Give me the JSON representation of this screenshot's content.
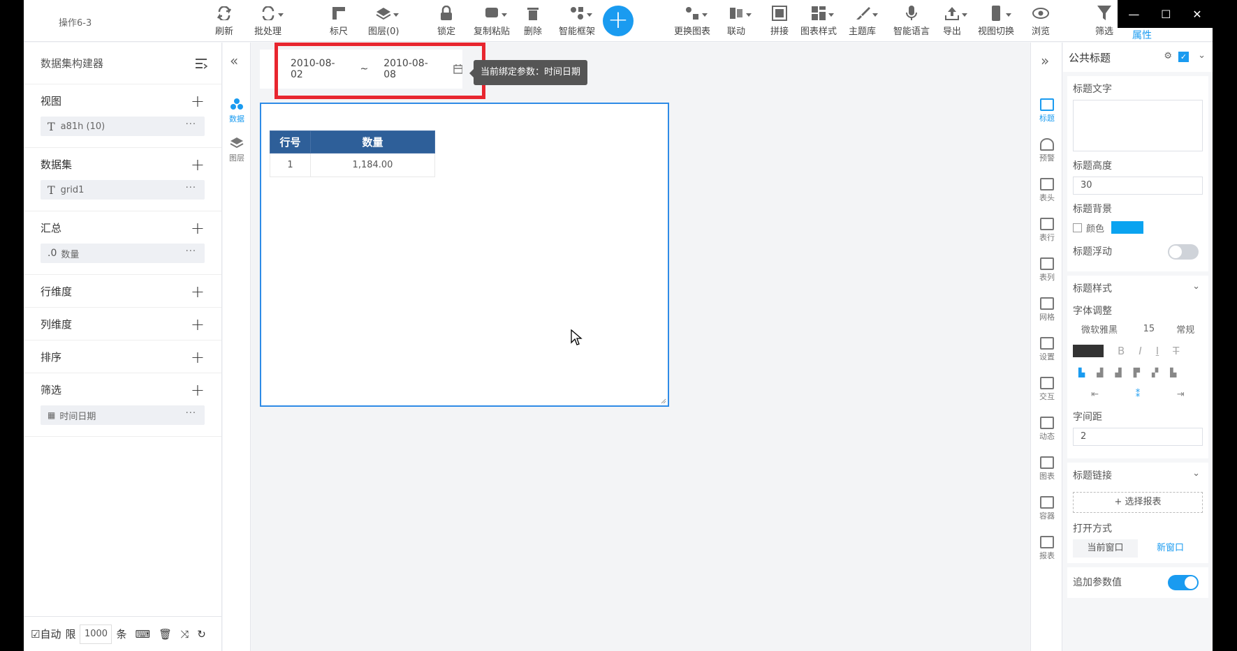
{
  "app": {
    "title": "操作6-3"
  },
  "toolbar": {
    "items": [
      {
        "label": "刷新"
      },
      {
        "label": "批处理"
      },
      {
        "label": "标尺"
      },
      {
        "label": "图层(0)"
      },
      {
        "label": "锁定"
      },
      {
        "label": "复制粘贴"
      },
      {
        "label": "删除"
      },
      {
        "label": "智能框架"
      },
      {
        "label": "更换图表"
      },
      {
        "label": "联动"
      },
      {
        "label": "拼接"
      },
      {
        "label": "图表样式"
      },
      {
        "label": "主题库"
      },
      {
        "label": "智能语言"
      },
      {
        "label": "导出"
      },
      {
        "label": "视图切换"
      },
      {
        "label": "浏览"
      },
      {
        "label": "筛选"
      }
    ],
    "add_label": "+",
    "props_tab": "属性"
  },
  "left": {
    "title": "数据集构建器",
    "sections": [
      {
        "title": "视图",
        "chip": "a81h (10)"
      },
      {
        "title": "数据集",
        "chip": "grid1"
      },
      {
        "title": "汇总",
        "chip": "数量",
        "chip_prefix": ".0"
      },
      {
        "title": "行维度"
      },
      {
        "title": "列维度"
      },
      {
        "title": "排序"
      },
      {
        "title": "筛选",
        "chip": "时间日期"
      }
    ],
    "footer": {
      "auto_label": "自动",
      "limit_label": "限",
      "limit_value": "1000",
      "unit": "条"
    }
  },
  "rail": {
    "items": [
      {
        "label": "数据"
      },
      {
        "label": "图层"
      }
    ]
  },
  "canvas": {
    "date_from": "2010-08-02",
    "date_sep": "~",
    "date_to": "2010-08-08",
    "tooltip": "当前绑定参数：时间日期",
    "table": {
      "headers": [
        "行号",
        "数量"
      ],
      "rows": [
        [
          "1",
          "1,184.00"
        ]
      ]
    }
  },
  "rrail": {
    "items": [
      {
        "label": "标题"
      },
      {
        "label": "预警"
      },
      {
        "label": "表头"
      },
      {
        "label": "表行"
      },
      {
        "label": "表列"
      },
      {
        "label": "网格"
      },
      {
        "label": "设置"
      },
      {
        "label": "交互"
      },
      {
        "label": "动态"
      },
      {
        "label": "图表"
      },
      {
        "label": "容器"
      },
      {
        "label": "报表"
      }
    ]
  },
  "props": {
    "title": "公共标题",
    "title_text_label": "标题文字",
    "title_height_label": "标题高度",
    "title_height": "30",
    "title_bg_label": "标题背景",
    "color_label": "颜色",
    "bg_color": "#0aa3f0",
    "float_label": "标题浮动",
    "style_label": "标题样式",
    "font_adjust_label": "字体调整",
    "font_family": "微软雅黑",
    "font_size": "15",
    "font_weight": "常规",
    "spacing_label": "字间距",
    "spacing": "2",
    "link_label": "标题链接",
    "select_report": "选择报表",
    "open_mode_label": "打开方式",
    "current_window": "当前窗口",
    "new_window": "新窗口",
    "append_param_label": "追加参数值",
    "accent": "#1a9bf0"
  }
}
